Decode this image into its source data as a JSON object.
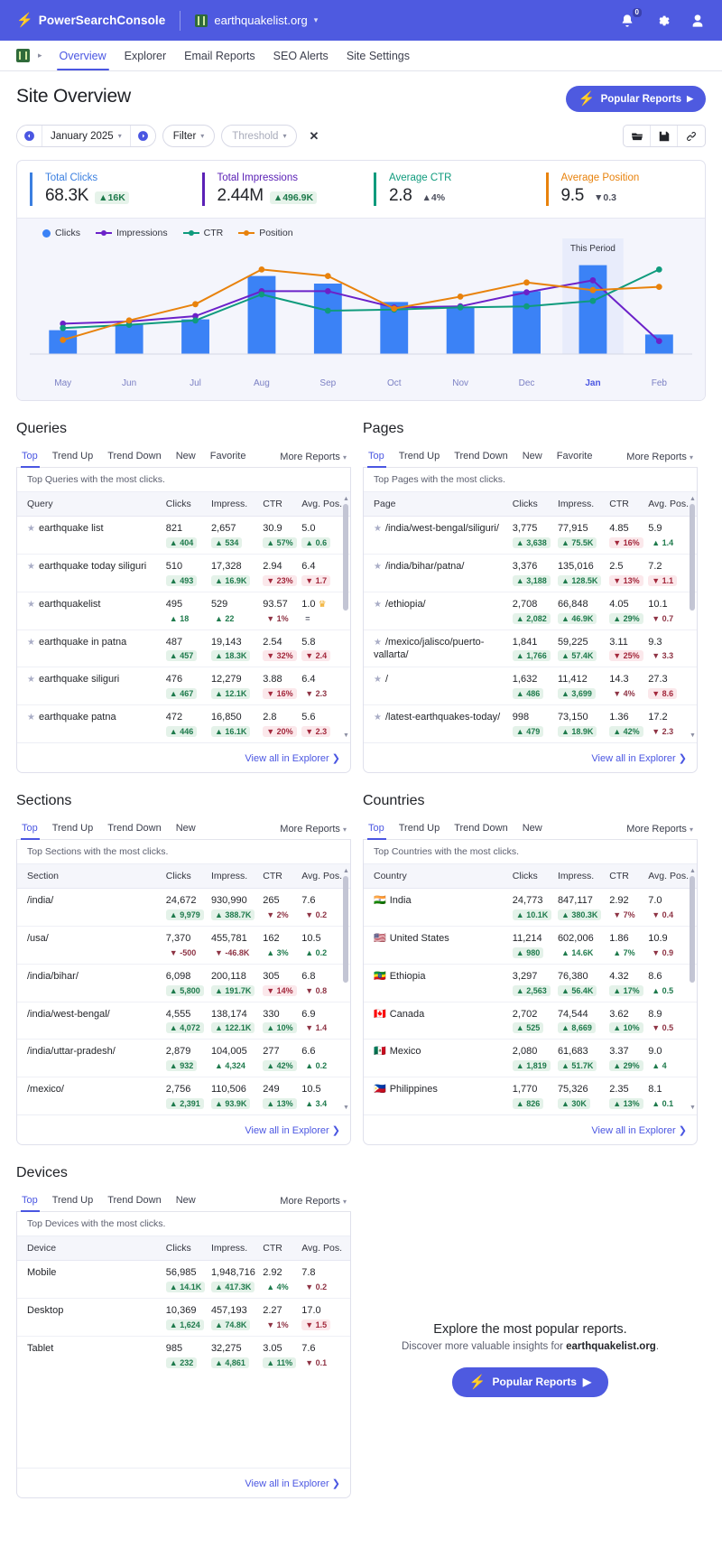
{
  "topbar": {
    "brand": "PowerSearchConsole",
    "site": "earthquakelist.org",
    "notification_count": "0",
    "icons": [
      "bell-icon",
      "gear-icon",
      "user-icon"
    ]
  },
  "subnav": {
    "items": [
      {
        "label": "Overview",
        "active": true
      },
      {
        "label": "Explorer",
        "active": false
      },
      {
        "label": "Email Reports",
        "active": false
      },
      {
        "label": "SEO Alerts",
        "active": false
      },
      {
        "label": "Site Settings",
        "active": false
      }
    ]
  },
  "header": {
    "title": "Site Overview",
    "popular_reports": "Popular Reports"
  },
  "toolbar": {
    "date": "January 2025",
    "filter": "Filter",
    "threshold": "Threshold",
    "clear": "✕"
  },
  "kpis": [
    {
      "label": "Total Clicks",
      "value": "68.3K",
      "delta": "16K",
      "dir": "up",
      "highlight": true,
      "color": "#3b7fe0"
    },
    {
      "label": "Total Impressions",
      "value": "2.44M",
      "delta": "496.9K",
      "dir": "up",
      "highlight": true,
      "color": "#5b21b6"
    },
    {
      "label": "Average CTR",
      "value": "2.8",
      "delta": "4%",
      "dir": "up",
      "highlight": false,
      "color": "#0f9b7d"
    },
    {
      "label": "Average Position",
      "value": "9.5",
      "delta": "0.3",
      "dir": "down",
      "highlight": false,
      "color": "#e8820c"
    }
  ],
  "chart_data": {
    "type": "bar",
    "title": "",
    "annotation": "This Period",
    "annotation_index": 8,
    "categories": [
      "May",
      "Jun",
      "Jul",
      "Aug",
      "Sep",
      "Oct",
      "Nov",
      "Dec",
      "Jan",
      "Feb"
    ],
    "current_index": 8,
    "legend": [
      {
        "name": "Clicks",
        "color": "#3b82f6",
        "marker": "bar"
      },
      {
        "name": "Impressions",
        "color": "#6b21c9",
        "marker": "line"
      },
      {
        "name": "CTR",
        "color": "#0f9b7d",
        "marker": "line"
      },
      {
        "name": "Position",
        "color": "#e8820c",
        "marker": "line"
      }
    ],
    "series": [
      {
        "name": "Clicks",
        "type": "bar",
        "color": "#3b82f6",
        "values": [
          22,
          27,
          32,
          72,
          65,
          48,
          43,
          58,
          82,
          18
        ]
      },
      {
        "name": "Impressions",
        "type": "line",
        "color": "#6b21c9",
        "values": [
          28,
          30,
          35,
          58,
          58,
          43,
          44,
          57,
          68,
          12
        ]
      },
      {
        "name": "CTR",
        "type": "line",
        "color": "#0f9b7d",
        "values": [
          24,
          27,
          31,
          55,
          40,
          41,
          43,
          44,
          49,
          78
        ]
      },
      {
        "name": "Position",
        "type": "line",
        "color": "#e8820c",
        "values": [
          13,
          31,
          46,
          78,
          72,
          42,
          53,
          66,
          59,
          62
        ]
      }
    ],
    "ylim": [
      0,
      100
    ],
    "grid": false,
    "legend_position": "top-left"
  },
  "sections": [
    {
      "title": "Queries",
      "tabs": [
        "Top",
        "Trend Up",
        "Trend Down",
        "New",
        "Favorite"
      ],
      "active_tab": "Top",
      "more": "More Reports",
      "subtitle": "Top Queries with the most clicks.",
      "columns": [
        "Query",
        "Clicks",
        "Impress.",
        "CTR",
        "Avg. Pos."
      ],
      "footer": "View all in Explorer",
      "star": true,
      "rows": [
        {
          "name": "earthquake list",
          "clicks": "821",
          "clicks_d": "404",
          "clicks_dir": "up",
          "imp": "2,657",
          "imp_d": "534",
          "imp_dir": "up",
          "ctr": "30.9",
          "ctr_d": "57%",
          "ctr_dir": "up",
          "pos": "5.0",
          "pos_d": "0.6",
          "pos_dir": "up"
        },
        {
          "name": "earthquake today siliguri",
          "clicks": "510",
          "clicks_d": "493",
          "clicks_dir": "up",
          "imp": "17,328",
          "imp_d": "16.9K",
          "imp_dir": "up",
          "ctr": "2.94",
          "ctr_d": "23%",
          "ctr_dir": "down",
          "pos": "6.4",
          "pos_d": "1.7",
          "pos_dir": "down"
        },
        {
          "name": "earthquakelist",
          "clicks": "495",
          "clicks_d": "18",
          "clicks_dir": "up-plain",
          "imp": "529",
          "imp_d": "22",
          "imp_dir": "up-plain",
          "ctr": "93.57",
          "ctr_d": "1%",
          "ctr_dir": "down-plain",
          "pos": "1.0",
          "pos_crown": true,
          "pos_d": "=",
          "pos_dir": "flat"
        },
        {
          "name": "earthquake in patna",
          "clicks": "487",
          "clicks_d": "457",
          "clicks_dir": "up",
          "imp": "19,143",
          "imp_d": "18.3K",
          "imp_dir": "up",
          "ctr": "2.54",
          "ctr_d": "32%",
          "ctr_dir": "down",
          "pos": "5.8",
          "pos_d": "2.4",
          "pos_dir": "down"
        },
        {
          "name": "earthquake siliguri",
          "clicks": "476",
          "clicks_d": "467",
          "clicks_dir": "up",
          "imp": "12,279",
          "imp_d": "12.1K",
          "imp_dir": "up",
          "ctr": "3.88",
          "ctr_d": "16%",
          "ctr_dir": "down",
          "pos": "6.4",
          "pos_d": "2.3",
          "pos_dir": "down-plain"
        },
        {
          "name": "earthquake patna",
          "clicks": "472",
          "clicks_d": "446",
          "clicks_dir": "up",
          "imp": "16,850",
          "imp_d": "16.1K",
          "imp_dir": "up",
          "ctr": "2.8",
          "ctr_d": "20%",
          "ctr_dir": "down",
          "pos": "5.6",
          "pos_d": "2.3",
          "pos_dir": "down"
        }
      ]
    },
    {
      "title": "Pages",
      "tabs": [
        "Top",
        "Trend Up",
        "Trend Down",
        "New",
        "Favorite"
      ],
      "active_tab": "Top",
      "more": "More Reports",
      "subtitle": "Top Pages with the most clicks.",
      "columns": [
        "Page",
        "Clicks",
        "Impress.",
        "CTR",
        "Avg. Pos."
      ],
      "footer": "View all in Explorer",
      "star": true,
      "rows": [
        {
          "name": "/india/west-bengal/siliguri/",
          "clicks": "3,775",
          "clicks_d": "3,638",
          "clicks_dir": "up",
          "imp": "77,915",
          "imp_d": "75.5K",
          "imp_dir": "up",
          "ctr": "4.85",
          "ctr_d": "16%",
          "ctr_dir": "down",
          "pos": "5.9",
          "pos_d": "1.4",
          "pos_dir": "up-plain"
        },
        {
          "name": "/india/bihar/patna/",
          "clicks": "3,376",
          "clicks_d": "3,188",
          "clicks_dir": "up",
          "imp": "135,016",
          "imp_d": "128.5K",
          "imp_dir": "up",
          "ctr": "2.5",
          "ctr_d": "13%",
          "ctr_dir": "down",
          "pos": "7.2",
          "pos_d": "1.1",
          "pos_dir": "down"
        },
        {
          "name": "/ethiopia/",
          "clicks": "2,708",
          "clicks_d": "2,082",
          "clicks_dir": "up",
          "imp": "66,848",
          "imp_d": "46.9K",
          "imp_dir": "up",
          "ctr": "4.05",
          "ctr_d": "29%",
          "ctr_dir": "up",
          "pos": "10.1",
          "pos_d": "0.7",
          "pos_dir": "down-plain"
        },
        {
          "name": "/mexico/jalisco/puerto-vallarta/",
          "clicks": "1,841",
          "clicks_d": "1,766",
          "clicks_dir": "up",
          "imp": "59,225",
          "imp_d": "57.4K",
          "imp_dir": "up",
          "ctr": "3.11",
          "ctr_d": "25%",
          "ctr_dir": "down",
          "pos": "9.3",
          "pos_d": "3.3",
          "pos_dir": "down-plain"
        },
        {
          "name": "/",
          "clicks": "1,632",
          "clicks_d": "486",
          "clicks_dir": "up",
          "imp": "11,412",
          "imp_d": "3,699",
          "imp_dir": "up",
          "ctr": "14.3",
          "ctr_d": "4%",
          "ctr_dir": "down-plain",
          "pos": "27.3",
          "pos_d": "8.6",
          "pos_dir": "down"
        },
        {
          "name": "/latest-earthquakes-today/",
          "clicks": "998",
          "clicks_d": "479",
          "clicks_dir": "up",
          "imp": "73,150",
          "imp_d": "18.9K",
          "imp_dir": "up",
          "ctr": "1.36",
          "ctr_d": "42%",
          "ctr_dir": "up",
          "pos": "17.2",
          "pos_d": "2.3",
          "pos_dir": "down-plain"
        }
      ]
    },
    {
      "title": "Sections",
      "tabs": [
        "Top",
        "Trend Up",
        "Trend Down",
        "New"
      ],
      "active_tab": "Top",
      "more": "More Reports",
      "subtitle": "Top Sections with the most clicks.",
      "columns": [
        "Section",
        "Clicks",
        "Impress.",
        "CTR",
        "Avg. Pos."
      ],
      "footer": "View all in Explorer",
      "star": false,
      "rows": [
        {
          "name": "/india/",
          "clicks": "24,672",
          "clicks_d": "9,979",
          "clicks_dir": "up",
          "imp": "930,990",
          "imp_d": "388.7K",
          "imp_dir": "up",
          "ctr": "265",
          "ctr_d": "2%",
          "ctr_dir": "down-plain",
          "pos": "7.6",
          "pos_d": "0.2",
          "pos_dir": "down-plain"
        },
        {
          "name": "/usa/",
          "clicks": "7,370",
          "clicks_d": "-500",
          "clicks_dir": "down-plain",
          "imp": "455,781",
          "imp_d": "-46.8K",
          "imp_dir": "down-plain",
          "ctr": "162",
          "ctr_d": "3%",
          "ctr_dir": "up-plain",
          "pos": "10.5",
          "pos_d": "0.2",
          "pos_dir": "up-plain"
        },
        {
          "name": "/india/bihar/",
          "clicks": "6,098",
          "clicks_d": "5,800",
          "clicks_dir": "up",
          "imp": "200,118",
          "imp_d": "191.7K",
          "imp_dir": "up",
          "ctr": "305",
          "ctr_d": "14%",
          "ctr_dir": "down",
          "pos": "6.8",
          "pos_d": "0.8",
          "pos_dir": "down-plain"
        },
        {
          "name": "/india/west-bengal/",
          "clicks": "4,555",
          "clicks_d": "4,072",
          "clicks_dir": "up",
          "imp": "138,174",
          "imp_d": "122.1K",
          "imp_dir": "up",
          "ctr": "330",
          "ctr_d": "10%",
          "ctr_dir": "up",
          "pos": "6.9",
          "pos_d": "1.4",
          "pos_dir": "down-plain"
        },
        {
          "name": "/india/uttar-pradesh/",
          "clicks": "2,879",
          "clicks_d": "932",
          "clicks_dir": "up",
          "imp": "104,005",
          "imp_d": "4,324",
          "imp_dir": "up-plain",
          "ctr": "277",
          "ctr_d": "42%",
          "ctr_dir": "up",
          "pos": "6.6",
          "pos_d": "0.2",
          "pos_dir": "up-plain"
        },
        {
          "name": "/mexico/",
          "clicks": "2,756",
          "clicks_d": "2,391",
          "clicks_dir": "up",
          "imp": "110,506",
          "imp_d": "93.9K",
          "imp_dir": "up",
          "ctr": "249",
          "ctr_d": "13%",
          "ctr_dir": "up",
          "pos": "10.5",
          "pos_d": "3.4",
          "pos_dir": "up-plain"
        }
      ]
    },
    {
      "title": "Countries",
      "tabs": [
        "Top",
        "Trend Up",
        "Trend Down",
        "New"
      ],
      "active_tab": "Top",
      "more": "More Reports",
      "subtitle": "Top Countries with the most clicks.",
      "columns": [
        "Country",
        "Clicks",
        "Impress.",
        "CTR",
        "Avg. Pos."
      ],
      "footer": "View all in Explorer",
      "star": false,
      "rows": [
        {
          "flag": "🇮🇳",
          "name": "India",
          "clicks": "24,773",
          "clicks_d": "10.1K",
          "clicks_dir": "up",
          "imp": "847,117",
          "imp_d": "380.3K",
          "imp_dir": "up",
          "ctr": "2.92",
          "ctr_d": "7%",
          "ctr_dir": "down-plain",
          "pos": "7.0",
          "pos_d": "0.4",
          "pos_dir": "down-plain"
        },
        {
          "flag": "🇺🇸",
          "name": "United States",
          "clicks": "11,214",
          "clicks_d": "980",
          "clicks_dir": "up",
          "imp": "602,006",
          "imp_d": "14.6K",
          "imp_dir": "up-plain",
          "ctr": "1.86",
          "ctr_d": "7%",
          "ctr_dir": "up-plain",
          "pos": "10.9",
          "pos_d": "0.9",
          "pos_dir": "down-plain"
        },
        {
          "flag": "🇪🇹",
          "name": "Ethiopia",
          "clicks": "3,297",
          "clicks_d": "2,563",
          "clicks_dir": "up",
          "imp": "76,380",
          "imp_d": "56.4K",
          "imp_dir": "up",
          "ctr": "4.32",
          "ctr_d": "17%",
          "ctr_dir": "up",
          "pos": "8.6",
          "pos_d": "0.5",
          "pos_dir": "up-plain"
        },
        {
          "flag": "🇨🇦",
          "name": "Canada",
          "clicks": "2,702",
          "clicks_d": "525",
          "clicks_dir": "up",
          "imp": "74,544",
          "imp_d": "8,669",
          "imp_dir": "up",
          "ctr": "3.62",
          "ctr_d": "10%",
          "ctr_dir": "up",
          "pos": "8.9",
          "pos_d": "0.5",
          "pos_dir": "down-plain"
        },
        {
          "flag": "🇲🇽",
          "name": "Mexico",
          "clicks": "2,080",
          "clicks_d": "1,819",
          "clicks_dir": "up",
          "imp": "61,683",
          "imp_d": "51.7K",
          "imp_dir": "up",
          "ctr": "3.37",
          "ctr_d": "29%",
          "ctr_dir": "up",
          "pos": "9.0",
          "pos_d": "4",
          "pos_dir": "up-plain"
        },
        {
          "flag": "🇵🇭",
          "name": "Philippines",
          "clicks": "1,770",
          "clicks_d": "826",
          "clicks_dir": "up",
          "imp": "75,326",
          "imp_d": "30K",
          "imp_dir": "up",
          "ctr": "2.35",
          "ctr_d": "13%",
          "ctr_dir": "up",
          "pos": "8.1",
          "pos_d": "0.1",
          "pos_dir": "up-plain"
        }
      ]
    },
    {
      "title": "Devices",
      "tabs": [
        "Top",
        "Trend Up",
        "Trend Down",
        "New"
      ],
      "active_tab": "Top",
      "more": "More Reports",
      "subtitle": "Top Devices with the most clicks.",
      "columns": [
        "Device",
        "Clicks",
        "Impress.",
        "CTR",
        "Avg. Pos."
      ],
      "footer": "View all in Explorer",
      "star": false,
      "rows": [
        {
          "name": "Mobile",
          "clicks": "56,985",
          "clicks_d": "14.1K",
          "clicks_dir": "up",
          "imp": "1,948,716",
          "imp_d": "417.3K",
          "imp_dir": "up",
          "ctr": "2.92",
          "ctr_d": "4%",
          "ctr_dir": "up-plain",
          "pos": "7.8",
          "pos_d": "0.2",
          "pos_dir": "down-plain"
        },
        {
          "name": "Desktop",
          "clicks": "10,369",
          "clicks_d": "1,624",
          "clicks_dir": "up",
          "imp": "457,193",
          "imp_d": "74.8K",
          "imp_dir": "up",
          "ctr": "2.27",
          "ctr_d": "1%",
          "ctr_dir": "down-plain",
          "pos": "17.0",
          "pos_d": "1.5",
          "pos_dir": "down"
        },
        {
          "name": "Tablet",
          "clicks": "985",
          "clicks_d": "232",
          "clicks_dir": "up",
          "imp": "32,275",
          "imp_d": "4,861",
          "imp_dir": "up",
          "ctr": "3.05",
          "ctr_d": "11%",
          "ctr_dir": "up",
          "pos": "7.6",
          "pos_d": "0.1",
          "pos_dir": "down-plain"
        }
      ]
    }
  ],
  "promo": {
    "heading": "Explore the most popular reports.",
    "sub_prefix": "Discover more valuable insights for ",
    "sub_site": "earthquakelist.org",
    "sub_suffix": ".",
    "button": "Popular Reports"
  }
}
